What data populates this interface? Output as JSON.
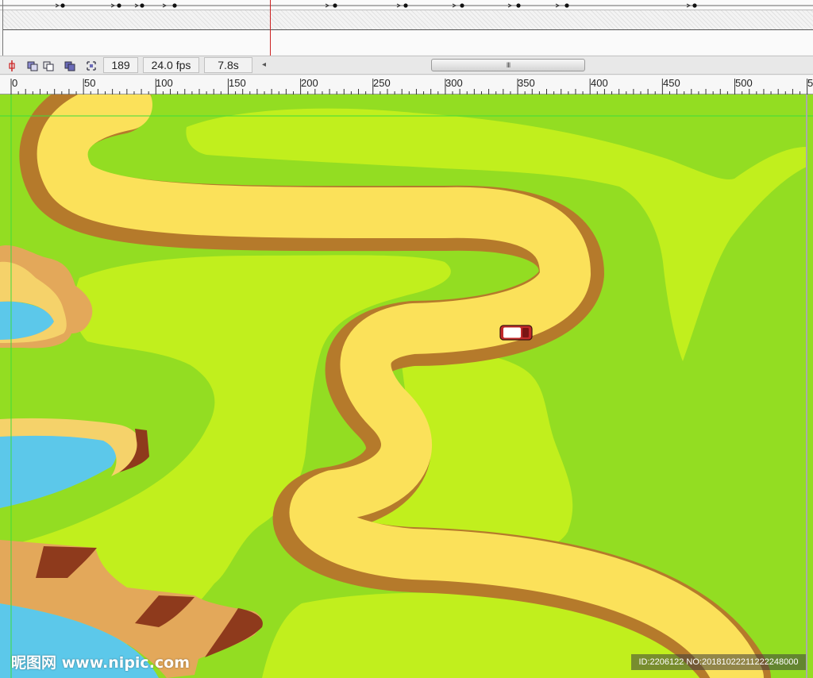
{
  "toolbar": {
    "current_frame": "189",
    "frame_rate": "24.0 fps",
    "elapsed_time": "7.8s",
    "scroll_left_arrow": "◂",
    "scroll_grip": "III"
  },
  "ruler": {
    "labels": [
      "0",
      "50",
      "100",
      "150",
      "200",
      "250",
      "300",
      "350",
      "400",
      "450",
      "500",
      "5"
    ]
  },
  "watermark": {
    "logo_text": "昵图网 www.nipic.com",
    "id_text": "ID:2206122 NO:20181022211222248000"
  },
  "colors": {
    "grass_dark": "#93dd22",
    "grass_light": "#c1ef1d",
    "road": "#fbe15a",
    "road_edge": "#b57a2b",
    "water": "#5cc8ea",
    "cliff": "#e3a85a",
    "cliff_dark": "#8e3a1c",
    "car_body": "#c22a2a"
  }
}
